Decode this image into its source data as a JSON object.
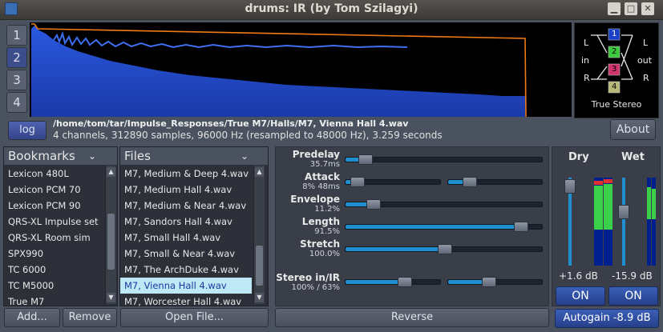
{
  "window": {
    "title": "drums: IR (by Tom Szilagyi)"
  },
  "program_buttons": [
    "1",
    "2",
    "3",
    "4"
  ],
  "true_stereo": {
    "label": "True Stereo",
    "in_label": "in",
    "out_label": "out",
    "l_label": "L",
    "r_label": "R",
    "boxes": [
      "1",
      "2",
      "3",
      "4"
    ],
    "colors": [
      "#1a40c8",
      "#3cc83c",
      "#d0346c",
      "#b8b878"
    ]
  },
  "log_button": "log",
  "about_button": "About",
  "file_path": "/home/tom/tar/Impulse_Responses/True M7/Halls/M7, Vienna Hall 4.wav",
  "file_info": "4 channels, 312890 samples, 96000 Hz (resampled to 48000 Hz), 3.259 seconds",
  "bookmarks": {
    "header": "Bookmarks",
    "items": [
      "Lexicon 480L",
      "Lexicon PCM 70",
      "Lexicon PCM 90",
      "QRS-XL Impulse set",
      "QRS-XL Room sim",
      "SPX990",
      "TC 6000",
      "TC M5000",
      "True M7"
    ]
  },
  "files": {
    "header": "Files",
    "items": [
      "M7, Medium & Deep 4.wav",
      "M7, Medium Hall 4.wav",
      "M7, Medium & Near 4.wav",
      "M7, Sandors Hall 4.wav",
      "M7, Small Hall 4.wav",
      "M7, Small & Near 4.wav",
      "M7, The ArchDuke 4.wav",
      "M7, Vienna Hall 4.wav",
      "M7, Worcester Hall 4.wav"
    ],
    "selected_index": 7
  },
  "buttons": {
    "add": "Add...",
    "remove": "Remove",
    "open_file": "Open File...",
    "reverse": "Reverse"
  },
  "controls": {
    "predelay": {
      "label": "Predelay",
      "value": "35.7ms",
      "level": 0.12
    },
    "attack": {
      "label": "Attack",
      "value": "8%  48ms",
      "level_a": 0.08,
      "level_b": 0.2
    },
    "envelope": {
      "label": "Envelope",
      "value": "11.2%",
      "level": 0.112
    },
    "length": {
      "label": "Length",
      "value": "91.5%",
      "level": 0.915
    },
    "stretch": {
      "label": "Stretch",
      "value": "100.0%",
      "level": 0.5
    },
    "stereo_in_ir": {
      "label": "Stereo in/IR",
      "value": "100% / 63%",
      "level_a": 0.62,
      "level_b": 0.4
    }
  },
  "mixer": {
    "dry": {
      "label": "Dry",
      "value": "+1.6 dB",
      "on": "ON"
    },
    "wet": {
      "label": "Wet",
      "value": "-15.9 dB",
      "on": "ON"
    },
    "autogain": "Autogain -8.9 dB"
  },
  "colors": {
    "accent": "#1f8fd0",
    "waveform": "#1f47c9",
    "envelope": "#f07a16"
  }
}
